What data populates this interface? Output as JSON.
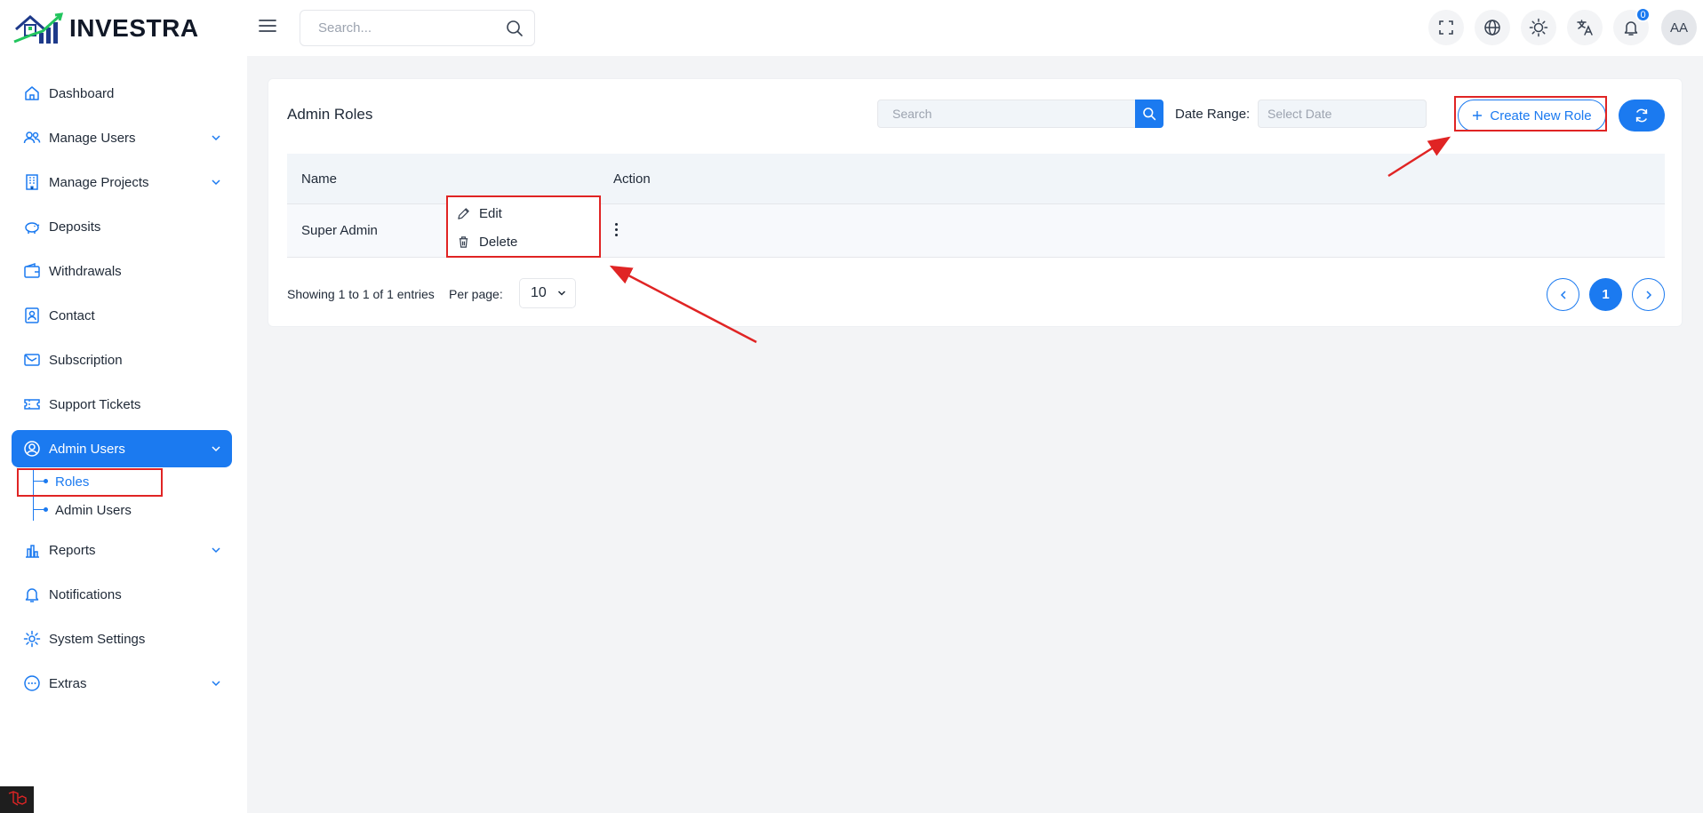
{
  "app": {
    "brand": "INVESTRA",
    "search_placeholder": "Search...",
    "notification_count": "0",
    "avatar_initials": "AA"
  },
  "sidebar": {
    "items": [
      {
        "label": "Dashboard",
        "icon": "home-icon"
      },
      {
        "label": "Manage Users",
        "icon": "users-icon"
      },
      {
        "label": "Manage Projects",
        "icon": "building-icon"
      },
      {
        "label": "Deposits",
        "icon": "piggy-bank-icon"
      },
      {
        "label": "Withdrawals",
        "icon": "wallet-icon"
      },
      {
        "label": "Contact",
        "icon": "contact-card-icon"
      },
      {
        "label": "Subscription",
        "icon": "subscription-icon"
      },
      {
        "label": "Support Tickets",
        "icon": "ticket-icon"
      },
      {
        "label": "Admin Users",
        "icon": "user-circle-icon"
      },
      {
        "label": "Reports",
        "icon": "bar-chart-icon"
      },
      {
        "label": "Notifications",
        "icon": "bell-icon"
      },
      {
        "label": "System Settings",
        "icon": "gear-icon"
      },
      {
        "label": "Extras",
        "icon": "more-circle-icon"
      }
    ],
    "admin_sub": [
      {
        "label": "Roles"
      },
      {
        "label": "Admin Users"
      }
    ]
  },
  "main": {
    "title": "Admin Roles",
    "search_placeholder": "Search",
    "date_range_label": "Date Range:",
    "date_placeholder": "Select Date",
    "create_button": "Create New Role",
    "table": {
      "columns": [
        "Name",
        "Action"
      ],
      "rows": [
        {
          "name": "Super Admin"
        }
      ]
    },
    "action_menu": {
      "edit": "Edit",
      "delete": "Delete"
    },
    "footer": {
      "showing": "Showing 1 to 1 of 1 entries",
      "per_page_label": "Per page:",
      "per_page_value": "10",
      "current_page": "1"
    }
  },
  "colors": {
    "accent": "#1b7af0",
    "annotation": "#e02424"
  }
}
